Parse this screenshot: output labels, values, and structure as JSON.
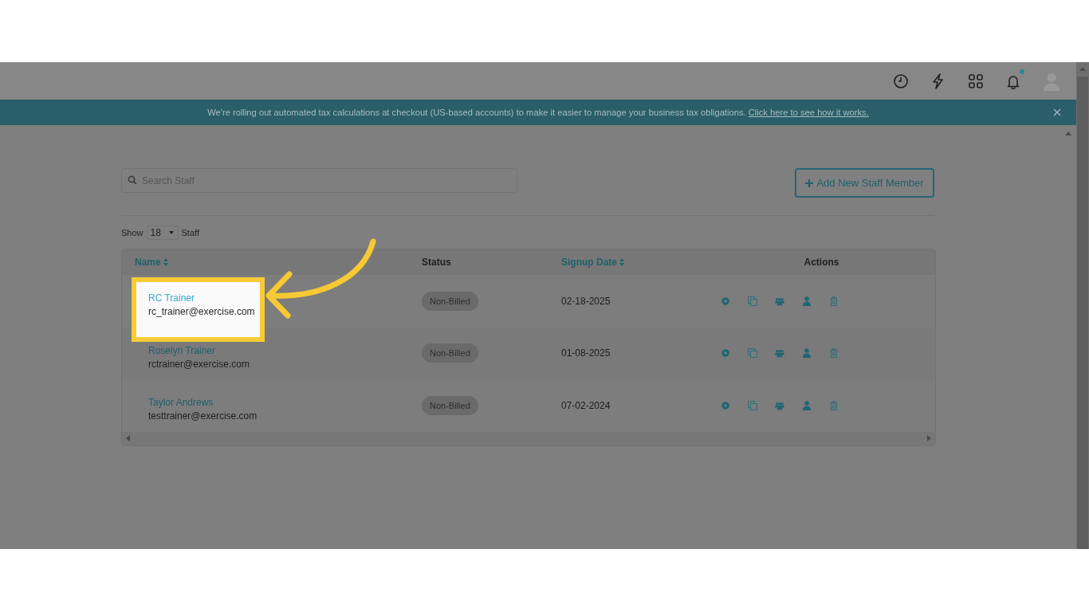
{
  "banner": {
    "message": "We're rolling out automated tax calculations at checkout (US-based accounts) to make it easier to manage your business tax obligations.",
    "link": "Click here to see how it works."
  },
  "search": {
    "placeholder": "Search Staff"
  },
  "add_button": "Add New Staff Member",
  "page_size": {
    "prefix": "Show",
    "value": "18",
    "suffix": "Staff"
  },
  "table": {
    "columns": [
      {
        "label": "Name",
        "sortable": true
      },
      {
        "label": "Status",
        "sortable": false
      },
      {
        "label": "Signup Date",
        "sortable": true
      },
      {
        "label": "Actions",
        "sortable": false
      }
    ],
    "rows": [
      {
        "name": "RC Trainer",
        "email": "rc_trainer@exercise.com",
        "status": "Non-Billed",
        "signup_date": "02-18-2025",
        "highlighted": true
      },
      {
        "name": "Roselyn Trainer",
        "email": "rctrainer@exercise.com",
        "status": "Non-Billed",
        "signup_date": "01-08-2025",
        "highlighted": false
      },
      {
        "name": "Taylor Andrews",
        "email": "testtrainer@exercise.com",
        "status": "Non-Billed",
        "signup_date": "07-02-2024",
        "highlighted": false
      }
    ]
  }
}
